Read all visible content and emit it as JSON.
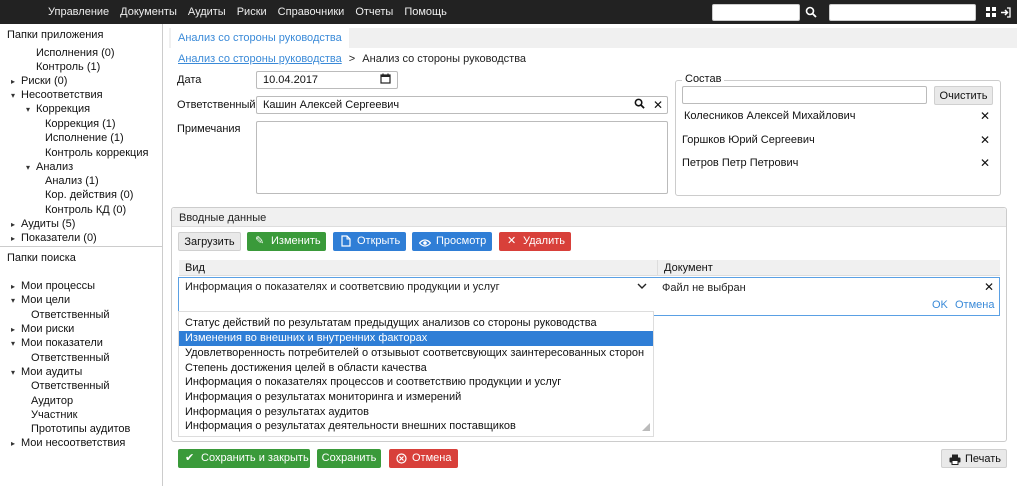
{
  "topbar": {
    "menu": [
      "Управление",
      "Документы",
      "Аудиты",
      "Риски",
      "Справочники",
      "Отчеты",
      "Помощь"
    ]
  },
  "sidebar": {
    "app_folders_title": "Папки приложения",
    "app_items": [
      {
        "label": "Исполнения (0)",
        "arrow": ""
      },
      {
        "label": "Контроль (1)",
        "arrow": ""
      },
      {
        "label": "Риски (0)",
        "arrow": "▸"
      },
      {
        "label": "Несоответствия",
        "arrow": "▾"
      },
      {
        "label": "Коррекция",
        "arrow": "▾"
      },
      {
        "label": "Коррекция (1)",
        "arrow": ""
      },
      {
        "label": "Исполнение (1)",
        "arrow": ""
      },
      {
        "label": "Контроль коррекция",
        "arrow": ""
      },
      {
        "label": "Анализ",
        "arrow": "▾"
      },
      {
        "label": "Анализ (1)",
        "arrow": ""
      },
      {
        "label": "Кор. действия (0)",
        "arrow": ""
      },
      {
        "label": "Контроль КД (0)",
        "arrow": ""
      },
      {
        "label": "Аудиты (5)",
        "arrow": "▸"
      },
      {
        "label": "Показатели (0)",
        "arrow": "▸"
      }
    ],
    "search_folders_title": "Папки поиска",
    "search_items": [
      {
        "label": "Мои процессы",
        "arrow": "▸"
      },
      {
        "label": "Мои цели",
        "arrow": "▾"
      },
      {
        "label": "Ответственный",
        "arrow": ""
      },
      {
        "label": "Мои риски",
        "arrow": "▸"
      },
      {
        "label": "Мои показатели",
        "arrow": "▾"
      },
      {
        "label": "Ответственный",
        "arrow": ""
      },
      {
        "label": "Мои аудиты",
        "arrow": "▾"
      },
      {
        "label": "Ответственный",
        "arrow": ""
      },
      {
        "label": "Аудитор",
        "arrow": ""
      },
      {
        "label": "Участник",
        "arrow": ""
      },
      {
        "label": "Прототипы аудитов",
        "arrow": ""
      },
      {
        "label": "Мои несоответствия",
        "arrow": "▸"
      }
    ]
  },
  "tab": {
    "label": "Анализ со стороны руководства"
  },
  "breadcrumb": {
    "link": "Анализ со стороны руководства",
    "sep": ">",
    "current": "Анализ со стороны руководства"
  },
  "form": {
    "date_label": "Дата",
    "date_value": "10.04.2017",
    "resp_label": "Ответственный",
    "resp_value": "Кашин Алексей Сергеевич",
    "notes_label": "Примечания",
    "notes_value": ""
  },
  "composition": {
    "legend": "Состав",
    "input_value": "",
    "clear_label": "Очистить",
    "members": [
      "Колесников Алексей Михайлович",
      "Горшков Юрий Сергеевич",
      "Петров Петр Петрович"
    ]
  },
  "inputs_panel": {
    "title": "Вводные данные",
    "load_label": "Загрузить",
    "edit_label": "Изменить",
    "open_label": "Открыть",
    "view_label": "Просмотр",
    "delete_label": "Удалить",
    "col_kind": "Вид",
    "col_doc": "Документ",
    "selected_kind": "Информация о показателях и соответсвию продукции и услуг",
    "doc_value": "Файл не выбран",
    "ok_label": "OK",
    "cancel_label": "Отмена",
    "options": [
      "Статус действий по результатам  предыдущих анализов со стороны руководства",
      "Изменения во внешних и внутренних факторах",
      "Удовлетворенность  потребителей о отзывыот соответсвующих заинтересованных сторон",
      "Степень достижения целей в области качества",
      "Информация о показателях процессов и соответствию продукции и услуг",
      "Информация  о результатах мониторинга и измерений",
      "Информация  о результатах аудитов",
      "Информация  о результатах деятельности внешних поставщиков"
    ],
    "highlighted_index": 1
  },
  "footer": {
    "save_close_label": "Сохранить и закрыть",
    "save_label": "Сохранить",
    "cancel_label": "Отмена",
    "print_label": "Печать"
  },
  "colors": {
    "accent": "#2f7ed6",
    "success": "#3a9a3a",
    "danger": "#d8403a",
    "topbar": "#222222"
  }
}
